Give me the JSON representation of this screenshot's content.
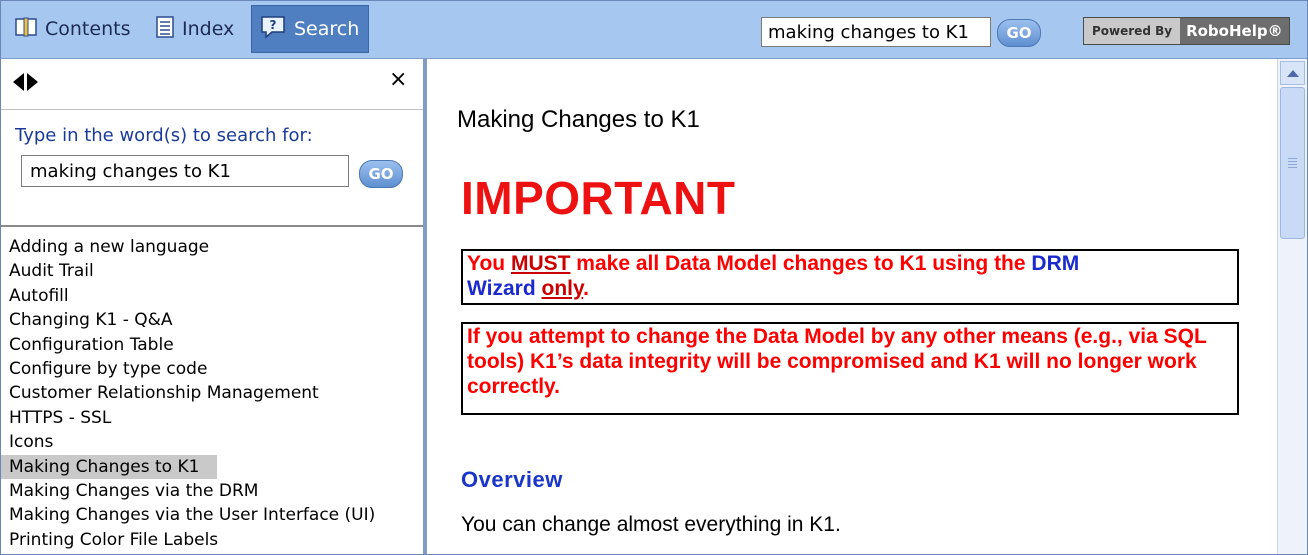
{
  "toolbar": {
    "contents_label": "Contents",
    "index_label": "Index",
    "search_label": "Search",
    "search_value": "making changes to K1",
    "go_label": "GO",
    "powered_by_label": "Powered By",
    "robohelp_label": "RoboHelp®"
  },
  "left_panel": {
    "search_prompt": "Type in the word(s) to search for:",
    "search_value": "making changes to K1",
    "go_label": "GO",
    "close_label": "×",
    "results": [
      "Adding a new language",
      "Audit Trail",
      "Autofill",
      "Changing K1 - Q&A",
      "Configuration Table",
      "Configure by type code",
      "Customer Relationship Management",
      "HTTPS - SSL",
      "Icons",
      "Making Changes to K1",
      "Making Changes via the DRM",
      "Making Changes via the User Interface (UI)",
      "Printing Color File Labels"
    ],
    "selected_index": 9
  },
  "content": {
    "title": "Making Changes to K1",
    "important_heading": "IMPORTANT",
    "box1": {
      "part1": "You ",
      "must": "MUST",
      "part2": " make all Data Model changes to K1 using the ",
      "drm": "DRM",
      "part3": "Wizard",
      "part4": " ",
      "only": "only",
      "part5": "."
    },
    "box2_text": "If you attempt to change the Data Model by any other means (e.g., via SQL tools) K1’s data integrity will be compromised and K1 will no longer work correctly.",
    "overview_heading": "Overview",
    "overview_text": "You can change almost everything in K1."
  },
  "colors": {
    "toolbar_bg": "#a6c8f0",
    "search_tab_bg": "#4f7ec1",
    "important_red": "#ee1111",
    "box_text_red": "#ff0000",
    "link_blue": "#1a35c9"
  }
}
